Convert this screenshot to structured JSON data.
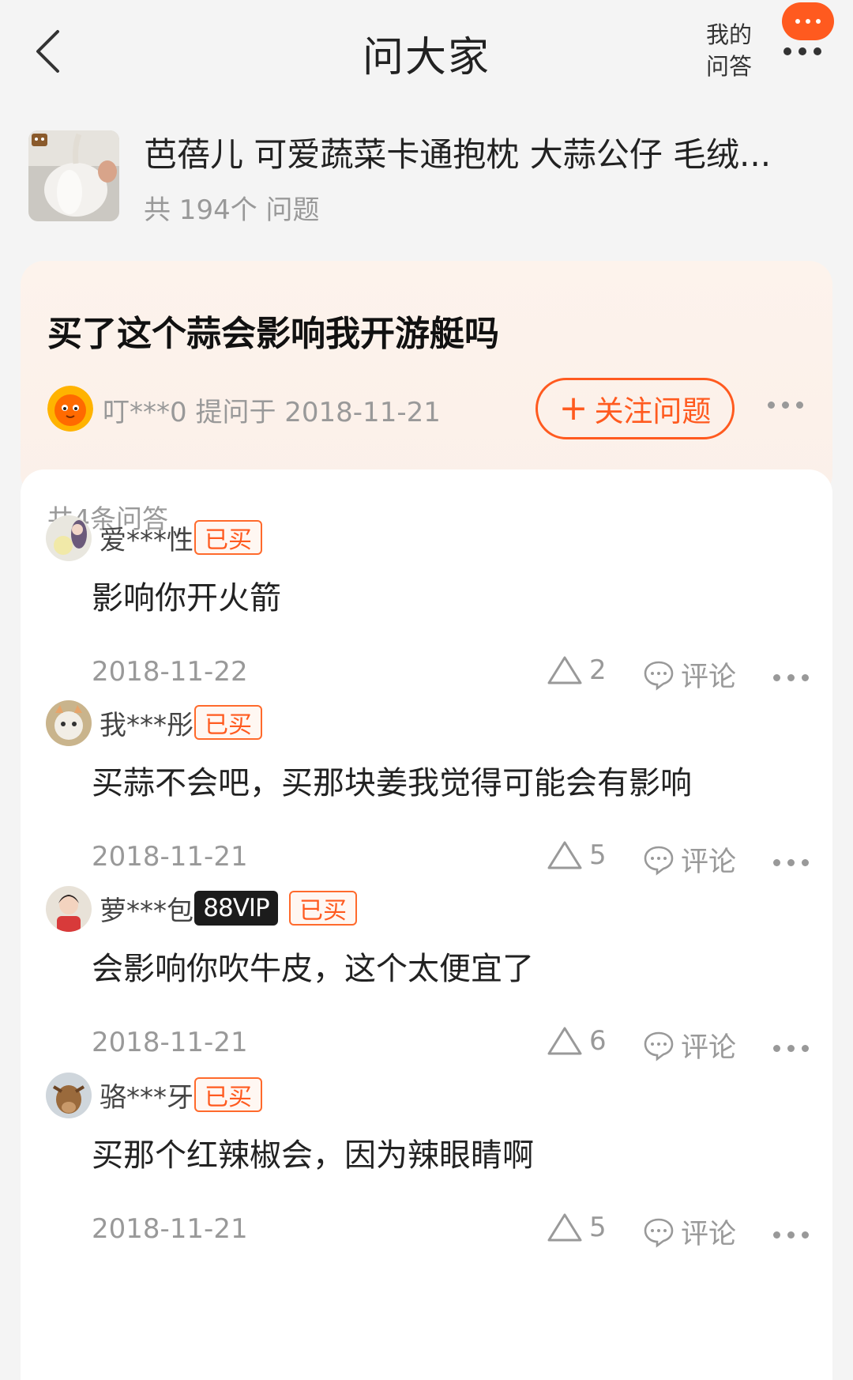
{
  "header": {
    "title": "问大家",
    "my_qa": "我的\n问答"
  },
  "product": {
    "name": "芭蓓儿 可爱蔬菜卡通抱枕 大蒜公仔 毛绒...",
    "count_text": "共 194个 问题"
  },
  "question": {
    "text": "买了这个蒜会影响我开游艇吗",
    "asker": "叮***0",
    "asked_on": "提问于 2018-11-21",
    "follow_label": "关注问题"
  },
  "answers_total": "共4条问答",
  "answers": [
    {
      "user": "爱***性",
      "vip": "",
      "tag": "已买",
      "text": "影响你开火箭",
      "date": "2018-11-22",
      "likes": "2",
      "comment_label": "评论"
    },
    {
      "user": "我***彤",
      "vip": "",
      "tag": "已买",
      "text": "买蒜不会吧，买那块姜我觉得可能会有影响",
      "date": "2018-11-21",
      "likes": "5",
      "comment_label": "评论"
    },
    {
      "user": "萝***包",
      "vip": "88VIP",
      "tag": "已买",
      "text": "会影响你吹牛皮，这个太便宜了",
      "date": "2018-11-21",
      "likes": "6",
      "comment_label": "评论"
    },
    {
      "user": "骆***牙",
      "vip": "",
      "tag": "已买",
      "text": "买那个红辣椒会，因为辣眼睛啊",
      "date": "2018-11-21",
      "likes": "5",
      "comment_label": "评论"
    }
  ],
  "colors": {
    "accent": "#ff5a1f",
    "muted": "#999999",
    "card_bg": "#fbf0e9"
  }
}
